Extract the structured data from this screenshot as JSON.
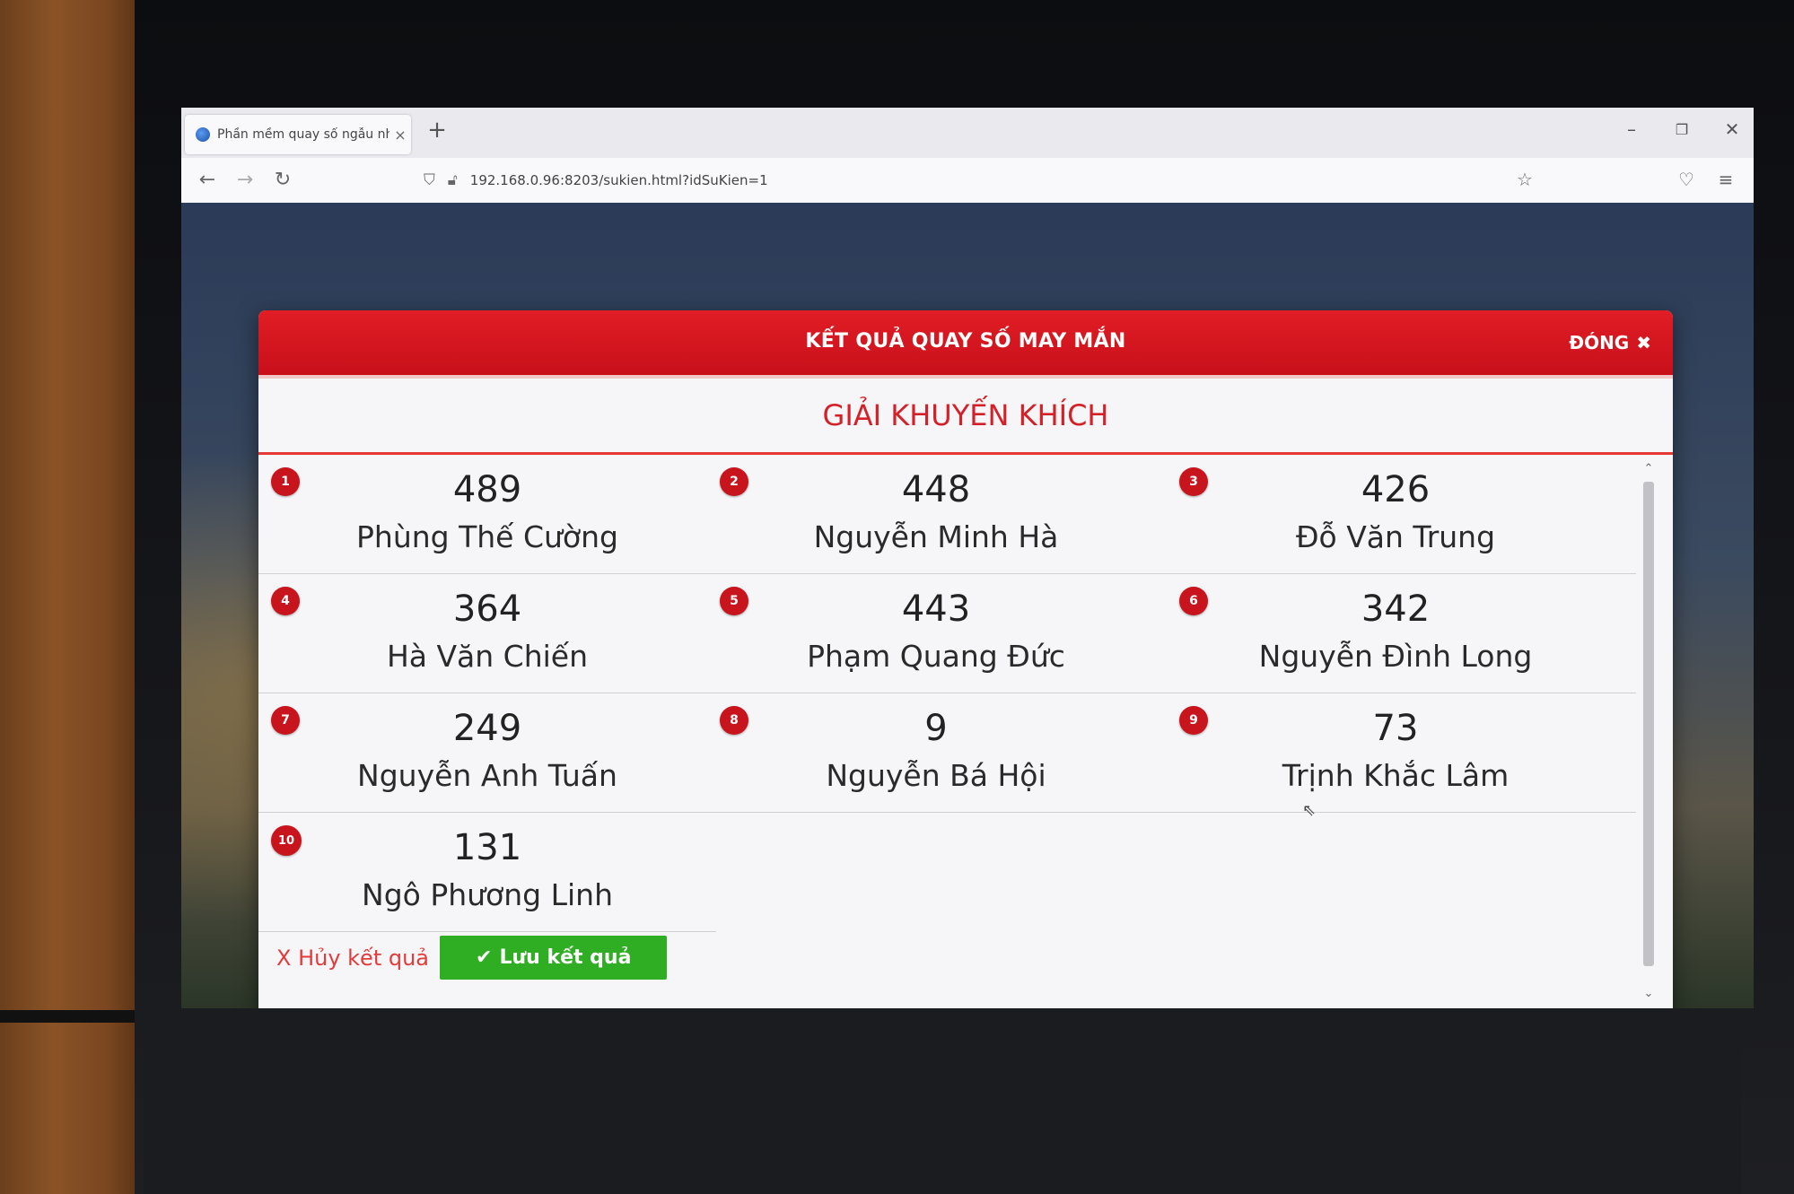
{
  "browser": {
    "tab_title": "Phần mềm quay số ngẫu nhiên",
    "tab_close": "×",
    "new_tab": "+",
    "url": "192.168.0.96:8203/sukien.html?idSuKien=1",
    "window_controls": {
      "minimize": "–",
      "restore": "❐",
      "close": "✕"
    },
    "nav": {
      "back": "←",
      "forward": "→",
      "reload": "↻",
      "shield": "⛉",
      "lock": "🔓︎",
      "star": "☆",
      "pocket": "♡",
      "menu": "≡"
    }
  },
  "modal": {
    "title": "KẾT QUẢ QUAY SỐ MAY MẮN",
    "close_label": "ĐÓNG",
    "close_icon": "✖",
    "prize_title": "GIẢI KHUYẾN KHÍCH",
    "winners": [
      {
        "rank": "1",
        "number": "489",
        "name": "Phùng Thế Cường"
      },
      {
        "rank": "2",
        "number": "448",
        "name": "Nguyễn Minh Hà"
      },
      {
        "rank": "3",
        "number": "426",
        "name": "Đỗ Văn Trung"
      },
      {
        "rank": "4",
        "number": "364",
        "name": "Hà Văn Chiến"
      },
      {
        "rank": "5",
        "number": "443",
        "name": "Phạm Quang Đức"
      },
      {
        "rank": "6",
        "number": "342",
        "name": "Nguyễn Đình Long"
      },
      {
        "rank": "7",
        "number": "249",
        "name": "Nguyễn Anh Tuấn"
      },
      {
        "rank": "8",
        "number": "9",
        "name": "Nguyễn Bá Hội"
      },
      {
        "rank": "9",
        "number": "73",
        "name": "Trịnh Khắc Lâm"
      },
      {
        "rank": "10",
        "number": "131",
        "name": "Ngô Phương Linh"
      }
    ],
    "cancel_label": "X Hủy kết quả",
    "save_icon": "✔",
    "save_label": "Lưu kết quả",
    "scroll_up": "⌃",
    "scroll_down": "⌄"
  },
  "colors": {
    "header_red": "#d7171f",
    "save_green": "#2fae24",
    "badge_red": "#c8141c",
    "cancel_red": "#e33b3b"
  }
}
